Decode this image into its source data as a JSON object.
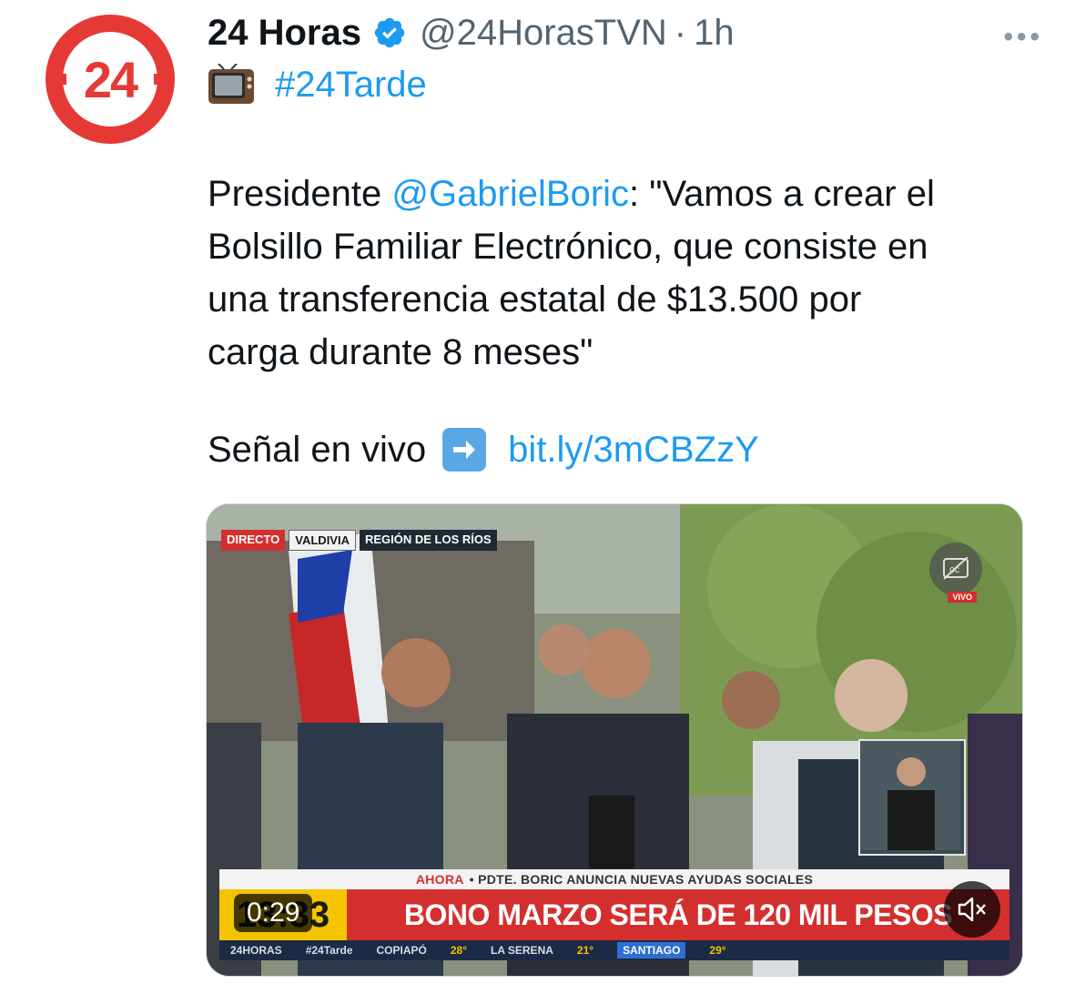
{
  "avatar": {
    "logo_text": "24"
  },
  "header": {
    "display_name": "24 Horas",
    "handle": "@24HorasTVN",
    "separator": "·",
    "time": "1h",
    "more": "•••"
  },
  "tweet": {
    "hashtag": "#24Tarde",
    "text_lines": {
      "l1_prefix": "Presidente ",
      "mention": "@GabrielBoric",
      "l1_suffix": ": \"Vamos a crear el",
      "l2": "Bolsillo Familiar Electrónico, que consiste en",
      "l3": "una transferencia estatal de $13.500 por",
      "l4": "carga durante  8 meses\""
    },
    "signal_label": "Señal en vivo",
    "signal_link": "bit.ly/3mCBZzY"
  },
  "media": {
    "tags": {
      "directo": "DIRECTO",
      "city": "VALDIVIA",
      "region": "REGIÓN DE LOS RÍOS"
    },
    "vivo_badge": "VIVO",
    "ahora_label": "AHORA",
    "ahora_text": "• PDTE. BORIC ANUNCIA NUEVAS AYUDAS SOCIALES",
    "clock": "13:33",
    "headline": "BONO MARZO SERÁ DE 120 MIL PESOS",
    "ticker": {
      "brand": "24HORAS",
      "hashtag": "#24Tarde",
      "city1": "COPIAPÓ",
      "temp1": "28°",
      "city2": "LA SERENA",
      "temp2": "21°",
      "city3": "SANTIAGO",
      "temp3": "29°"
    },
    "duration": "0:29"
  },
  "colors": {
    "accent": "#1d9bf0",
    "brand_red": "#e53935",
    "secondary_text": "#536471"
  }
}
